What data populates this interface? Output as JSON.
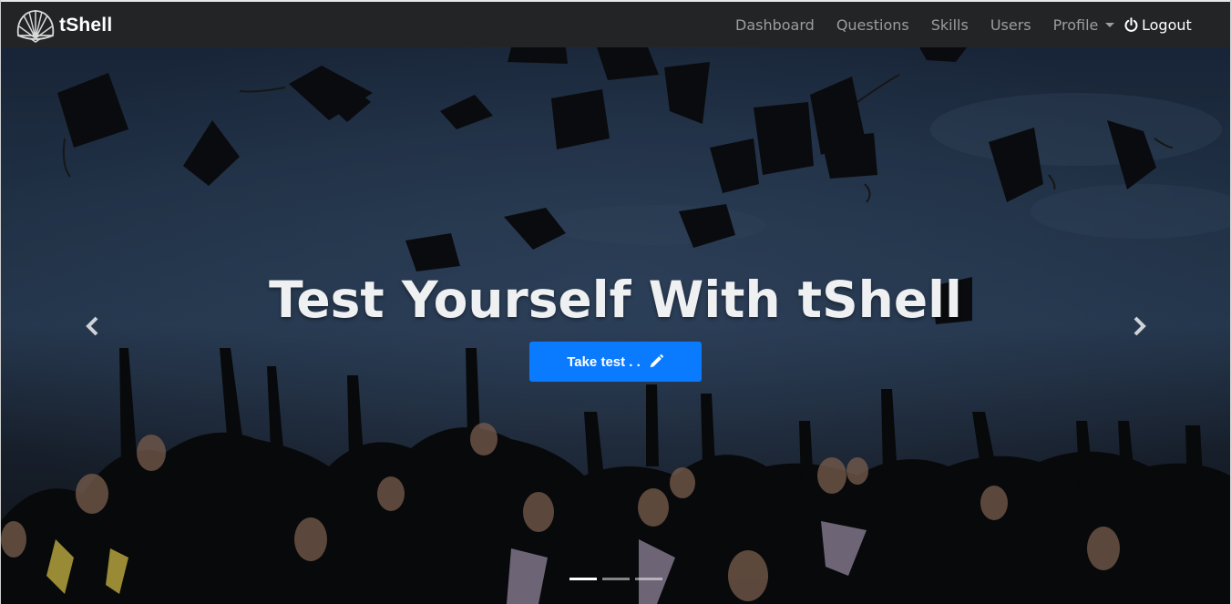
{
  "brand": {
    "name": "tShell",
    "logo_icon": "shell-icon"
  },
  "nav": {
    "items": [
      {
        "label": "Dashboard"
      },
      {
        "label": "Questions"
      },
      {
        "label": "Skills"
      },
      {
        "label": "Users"
      },
      {
        "label": "Profile",
        "dropdown": true
      }
    ],
    "logout": {
      "label": "Logout",
      "icon": "power-icon"
    }
  },
  "hero": {
    "title": "Test Yourself With tShell",
    "cta_label": "Take test . .",
    "cta_icon": "pencil-icon",
    "cta_color": "#0a7bff",
    "prev_icon": "chevron-left-icon",
    "next_icon": "chevron-right-icon",
    "slides": 3,
    "active_slide": 1,
    "background_image": "graduates throwing caps in the air"
  },
  "colors": {
    "navbar_bg": "#232425",
    "nav_link": "#9a9da1",
    "accent": "#0a7bff"
  }
}
